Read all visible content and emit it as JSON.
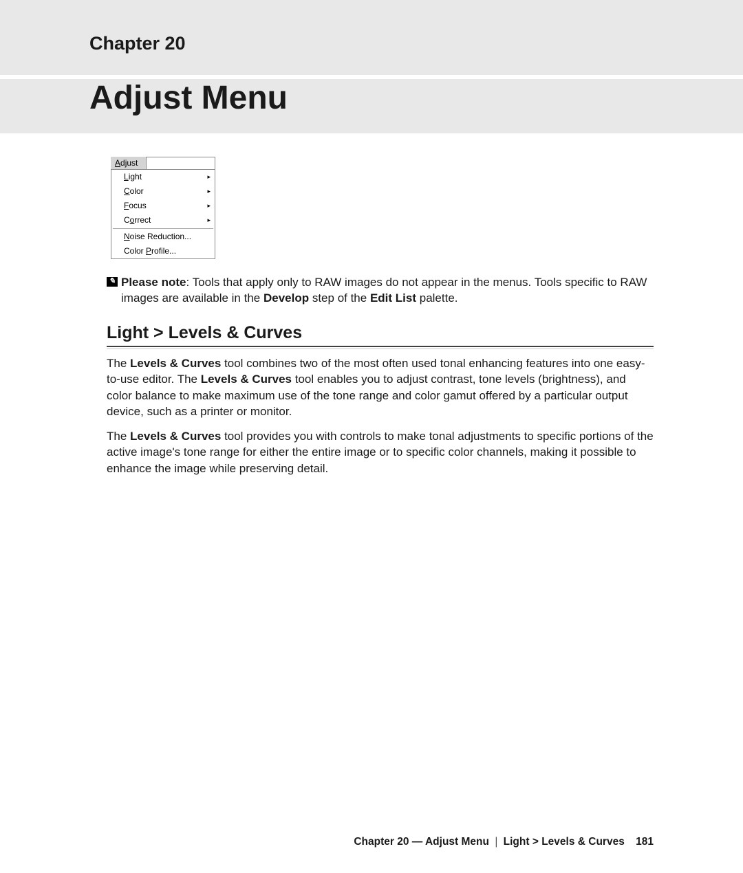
{
  "header": {
    "chapter_label": "Chapter 20",
    "chapter_title": "Adjust Menu"
  },
  "adjust_menu": {
    "title": "Adjust",
    "items": [
      {
        "label": "Light",
        "submenu": true,
        "underline_index": 0
      },
      {
        "label": "Color",
        "submenu": true,
        "underline_index": 0
      },
      {
        "label": "Focus",
        "submenu": true,
        "underline_index": 0
      },
      {
        "label": "Correct",
        "submenu": true,
        "underline_index": 1
      }
    ],
    "items2": [
      {
        "label": "Noise Reduction...",
        "submenu": false,
        "underline_index": 0
      },
      {
        "label": "Color Profile...",
        "submenu": false,
        "underline_index": 6
      }
    ]
  },
  "note": {
    "icon_glyph": "✎",
    "lead_bold": "Please note",
    "text_after_lead": ": Tools that apply only to RAW images do not appear in the menus. Tools specific to RAW images are available in the ",
    "bold1": "Develop",
    "mid": " step of the ",
    "bold2": "Edit List",
    "tail": " palette."
  },
  "section": {
    "heading": "Light > Levels & Curves",
    "para1_pre": "The ",
    "para1_b1": "Levels & Curves",
    "para1_mid1": " tool combines two of the most often used tonal enhancing features into one easy-to-use editor. The ",
    "para1_b2": "Levels & Curves",
    "para1_post": " tool enables you to adjust contrast, tone levels (brightness), and color balance to make maximum use of the tone range and color gamut offered by a particular output device, such as a printer or monitor.",
    "para2_pre": "The ",
    "para2_b1": "Levels & Curves",
    "para2_post": " tool provides you with controls to make tonal adjustments to specific portions of the active image's tone range for either the entire image or to specific color channels, making it possible to enhance the image while preserving detail."
  },
  "footer": {
    "chapter": "Chapter 20 — Adjust Menu",
    "separator": "|",
    "breadcrumb": "Light > Levels & Curves",
    "page_number": "181"
  }
}
